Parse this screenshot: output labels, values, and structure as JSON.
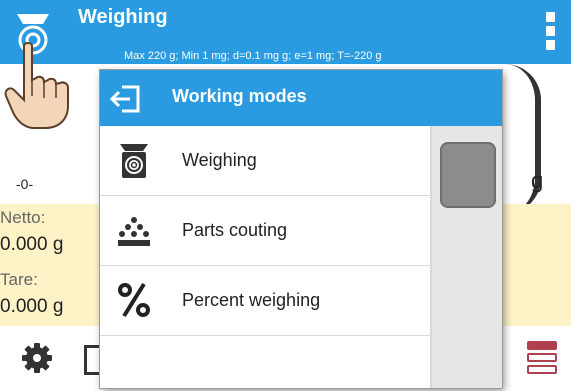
{
  "header": {
    "title": "Weighing",
    "subtitle": "Max 220 g; Min 1 mg; d=0.1 mg g; e=1 mg; T=-220 g"
  },
  "display": {
    "zero_indicator": "-0-",
    "unit": "g"
  },
  "info": {
    "netto_label": "Netto:",
    "netto_value": "0.000 g",
    "tare_label": "Tare:",
    "tare_value": "0.000 g"
  },
  "modal": {
    "title": "Working modes",
    "items": [
      {
        "label": "Weighing",
        "icon": "scale-icon"
      },
      {
        "label": "Parts couting",
        "icon": "parts-counting-icon"
      },
      {
        "label": "Percent weighing",
        "icon": "percent-icon"
      }
    ]
  },
  "colors": {
    "accent": "#2a9be0",
    "info_panel": "#fdf3c6",
    "database_icon": "#b04050"
  }
}
